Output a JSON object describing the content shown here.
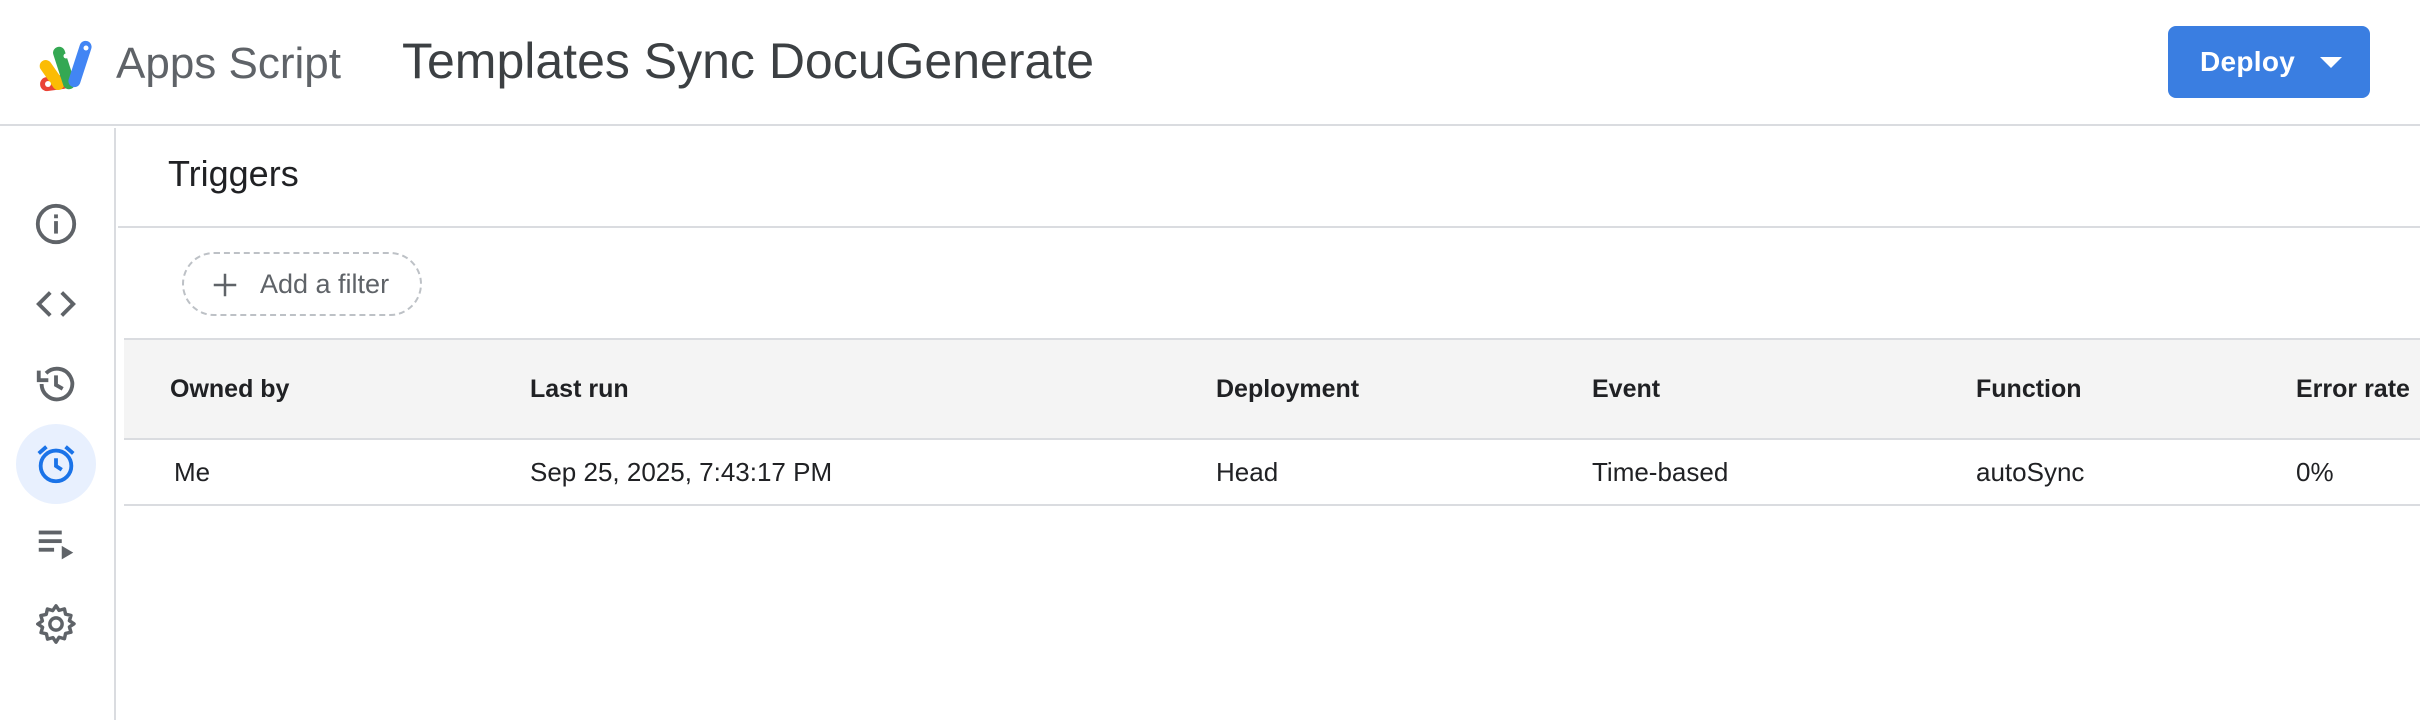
{
  "header": {
    "product_name": "Apps Script",
    "project_title": "Templates Sync DocuGenerate",
    "deploy_label": "Deploy",
    "logo_icon": "apps-script-logo",
    "deploy_menu_icon": "arrow-drop-down-icon"
  },
  "colors": {
    "accent": "#3a7ee1",
    "active_nav_bg": "#e8f0fe",
    "active_nav_icon": "#1a73e8",
    "icon_gray": "#5f6368",
    "divider": "#dadce0",
    "table_header_bg": "#f4f4f4"
  },
  "sidebar": {
    "items": [
      {
        "name": "Overview",
        "icon": "info-icon",
        "active": false
      },
      {
        "name": "Editor",
        "icon": "code-icon",
        "active": false
      },
      {
        "name": "Project history",
        "icon": "history-icon",
        "active": false
      },
      {
        "name": "Triggers",
        "icon": "alarm-icon",
        "active": true
      },
      {
        "name": "Executions",
        "icon": "playlist-play-icon",
        "active": false
      },
      {
        "name": "Project Settings",
        "icon": "gear-icon",
        "active": false
      }
    ]
  },
  "main": {
    "title": "Triggers",
    "filter": {
      "label": "Add a filter",
      "icon": "plus-icon"
    },
    "table": {
      "columns": [
        "Owned by",
        "Last run",
        "Deployment",
        "Event",
        "Function",
        "Error rate"
      ],
      "rows": [
        [
          "Me",
          "Sep 25, 2025, 7:43:17 PM",
          "Head",
          "Time-based",
          "autoSync",
          "0%"
        ]
      ]
    }
  }
}
